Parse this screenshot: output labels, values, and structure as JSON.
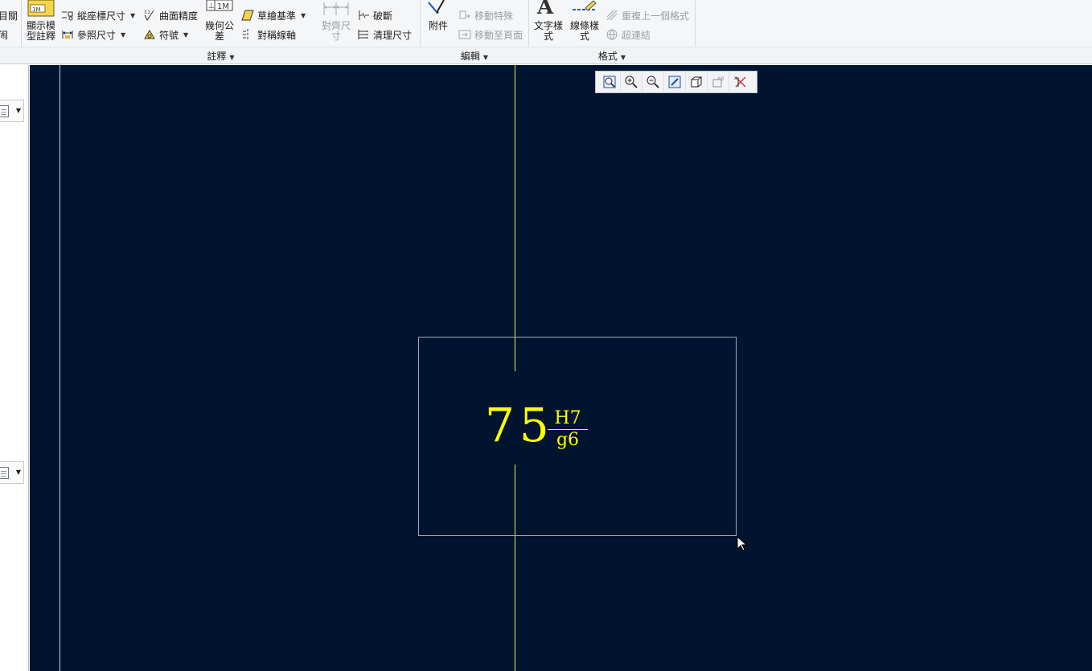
{
  "ribbon": {
    "left_partial": {
      "top": "目關",
      "bottom": "闹"
    },
    "annotate": {
      "show_model": "顯示模型註釋",
      "show_model_line1": "顯示模",
      "show_model_line2": "型註釋",
      "ordinate_dim": "縱座標尺寸",
      "reference_dim": "參照尺寸",
      "surface_finish": "曲面精度",
      "symbol": "符號",
      "geom_tol_line1": "幾何公",
      "geom_tol_line2": "差",
      "datum_feature": "草繪基準",
      "symmetry_axis": "對稱線軸",
      "align_dim_line1": "對齊尺",
      "align_dim_line2": "寸",
      "break": "破斷",
      "cleanup_dim": "清理尺寸",
      "icon_label_1m": "1M",
      "icon_label_1m_small": "1M"
    },
    "edit": {
      "attachment": "附件",
      "move_special": "移動特殊",
      "move_to_page": "移動至頁面"
    },
    "format": {
      "text_style_line1": "文字樣",
      "text_style_line2": "式",
      "line_style_line1": "線條樣",
      "line_style_line2": "式",
      "repeat_last_format": "重複上一個格式",
      "hyperlink": "超連結",
      "text_icon_glyph": "A"
    },
    "groups": {
      "annotate": "註釋",
      "edit": "編輯",
      "format": "格式"
    }
  },
  "canvas": {
    "dimension": {
      "nominal": "75",
      "upper": "H7",
      "lower": "g6"
    },
    "colors": {
      "background": "#001430",
      "annotation": "#ffff00",
      "centerline": "#e8ee4a",
      "selection": "#9da7b5"
    }
  },
  "view_toolbar": {
    "buttons": [
      "refit-icon",
      "zoom-in-icon",
      "zoom-out-icon",
      "repaint-icon",
      "display-style-icon",
      "annotation-display-icon",
      "datum-display-icon"
    ]
  }
}
